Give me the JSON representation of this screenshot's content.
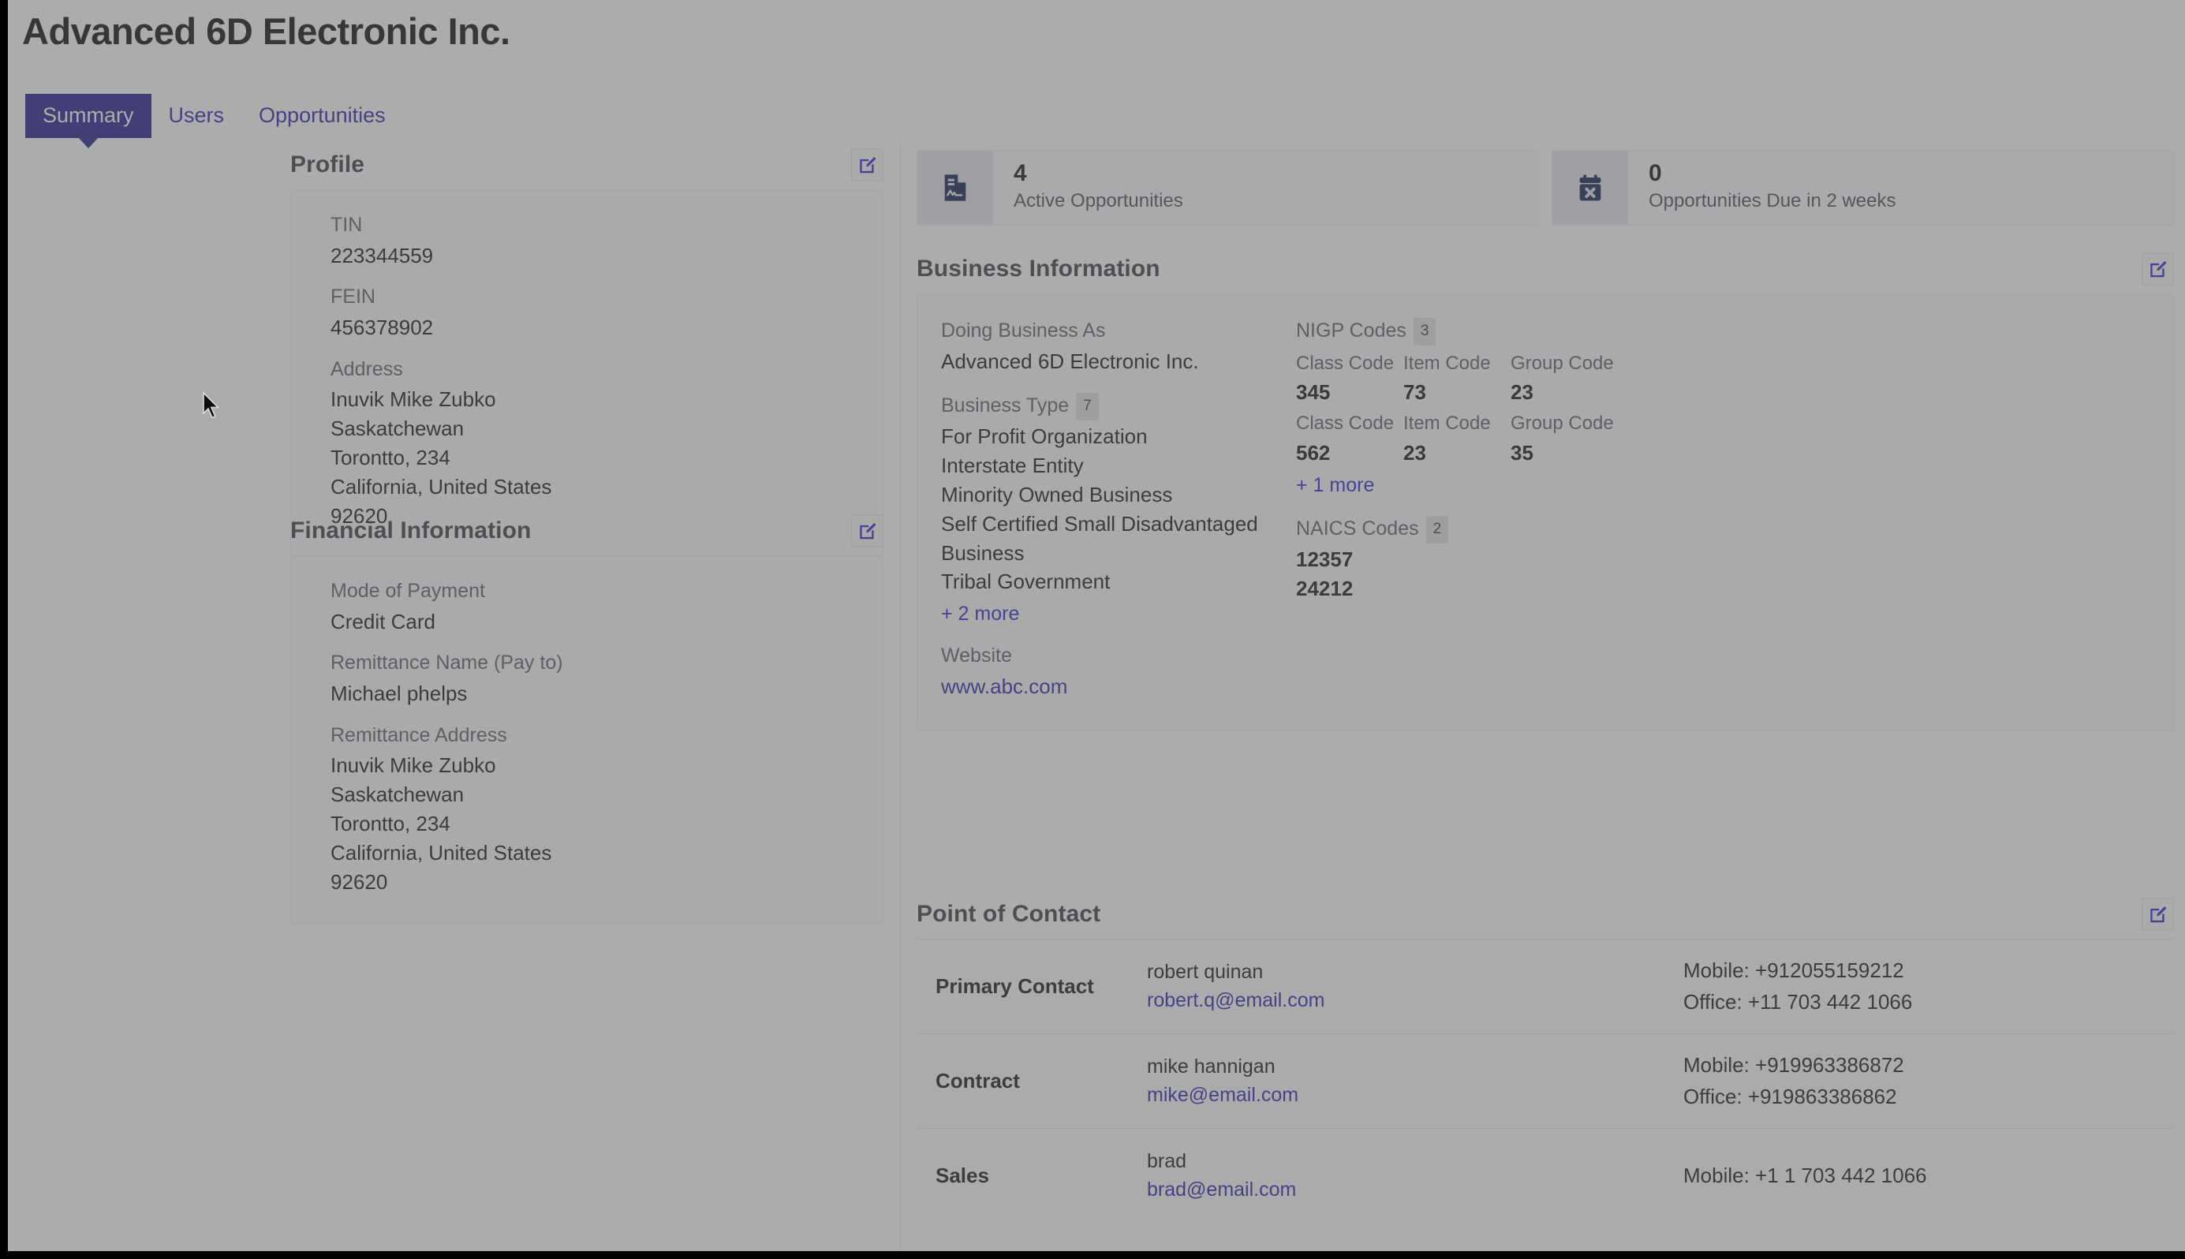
{
  "header": {
    "company_title": "Advanced 6D Electronic Inc.",
    "tabs": [
      {
        "label": "Summary",
        "active": true
      },
      {
        "label": "Users",
        "active": false
      },
      {
        "label": "Opportunities",
        "active": false
      }
    ]
  },
  "colors": {
    "accent": "#231a8e",
    "link": "#2a1fae",
    "icon_navy": "#0d2050",
    "label_grey": "#5f5f6b"
  },
  "profile": {
    "section_title": "Profile",
    "edit_icon": "edit-pencil-icon",
    "fields": [
      {
        "label": "TIN",
        "value": "223344559"
      },
      {
        "label": "FEIN",
        "value": "456378902"
      },
      {
        "label": "Address",
        "value_lines": [
          "Inuvik Mike Zubko",
          "Saskatchewan",
          "Torontto, 234",
          "California, United States",
          "92620"
        ]
      }
    ]
  },
  "financial": {
    "section_title": "Financial Information",
    "edit_icon": "edit-pencil-icon",
    "fields": [
      {
        "label": "Mode of Payment",
        "value": "Credit Card"
      },
      {
        "label": "Remittance Name (Pay to)",
        "value": "Michael phelps"
      },
      {
        "label": "Remittance Address",
        "value_lines": [
          "Inuvik Mike Zubko",
          "Saskatchewan",
          "Torontto, 234",
          "California, United States",
          "92620"
        ]
      }
    ]
  },
  "kpis": [
    {
      "icon": "document-activity-icon",
      "value": "4",
      "label": "Active Opportunities"
    },
    {
      "icon": "calendar-x-icon",
      "value": "0",
      "label": "Opportunities Due in 2 weeks"
    }
  ],
  "business_information": {
    "section_title": "Business Information",
    "edit_icon": "edit-pencil-icon",
    "doing_business_as": {
      "label": "Doing Business As",
      "value": "Advanced 6D Electronic Inc."
    },
    "business_type": {
      "label": "Business Type",
      "count": "7",
      "items": [
        "For Profit Organization",
        "Interstate Entity",
        "Minority Owned Business",
        "Self Certified Small Disadvantaged Business",
        "Tribal Government"
      ],
      "more_link": "+ 2 more"
    },
    "website": {
      "label": "Website",
      "value": "www.abc.com"
    },
    "nigp_codes": {
      "label": "NIGP Codes",
      "count": "3",
      "columns": [
        "Class Code",
        "Item Code",
        "Group Code"
      ],
      "rows": [
        {
          "class_code": "345",
          "item_code": "73",
          "group_code": "23"
        },
        {
          "class_code": "562",
          "item_code": "23",
          "group_code": "35"
        }
      ],
      "more_link": "+ 1 more"
    },
    "naics_codes": {
      "label": "NAICS Codes",
      "count": "2",
      "values": [
        "12357",
        "24212"
      ]
    }
  },
  "point_of_contact": {
    "section_title": "Point of Contact",
    "edit_icon": "edit-pencil-icon",
    "rows": [
      {
        "role": "Primary Contact",
        "name": "robert quinan",
        "email": "robert.q@email.com",
        "mobile": "Mobile: +912055159212",
        "office": "Office: +11 703 442 1066"
      },
      {
        "role": "Contract",
        "name": "mike hannigan",
        "email": "mike@email.com",
        "mobile": "Mobile: +919963386872",
        "office": "Office: +919863386862"
      },
      {
        "role": "Sales",
        "name": "brad",
        "email": "brad@email.com",
        "mobile": "Mobile: +1 1 703 442 1066",
        "office": ""
      }
    ]
  }
}
